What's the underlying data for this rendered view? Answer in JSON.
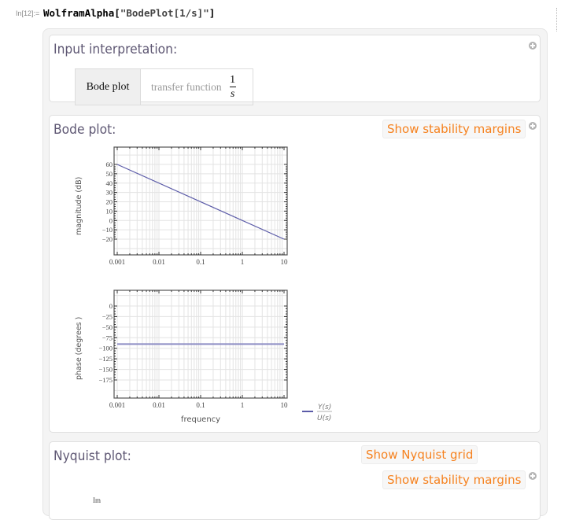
{
  "cell": {
    "in_label": "In[12]:=",
    "code_prefix": "WolframAlpha[",
    "code_string": "\"BodePlot[1/s]\"",
    "code_suffix": "]"
  },
  "pods": {
    "input_interpretation": {
      "title": "Input interpretation:",
      "head": "Bode plot",
      "label": "transfer function",
      "numerator": "1",
      "denominator": "s"
    },
    "bode": {
      "title": "Bode plot:",
      "stability_button": "Show stability margins",
      "magnitude_ylabel": "magnitude   (dB)",
      "phase_ylabel": "phase   (degrees )",
      "xlabel": "frequency",
      "legend_num": "Y(s)",
      "legend_den": "U(s)"
    },
    "nyquist": {
      "title": "Nyquist plot:",
      "grid_button": "Show Nyquist grid",
      "stability_button": "Show stability margins",
      "im_label": "Im"
    }
  },
  "colors": {
    "accent_orange": "#f6821f",
    "pod_title": "#5e5773",
    "series": "#5b5ba8"
  },
  "chart_data": [
    {
      "type": "line",
      "title": "magnitude",
      "xlabel": "",
      "ylabel": "magnitude (dB)",
      "xscale": "log",
      "xlim": [
        0.001,
        10
      ],
      "ylim": [
        -20,
        60
      ],
      "xticks": [
        "0.001",
        "0.01",
        "0.1",
        "1",
        "10"
      ],
      "yticks": [
        "60",
        "50",
        "40",
        "30",
        "20",
        "10",
        "0",
        "-10",
        "-20"
      ],
      "grid": true,
      "series": [
        {
          "name": "Y(s)/U(s)",
          "x": [
            0.001,
            10
          ],
          "y": [
            60,
            -20
          ]
        }
      ]
    },
    {
      "type": "line",
      "title": "phase",
      "xlabel": "frequency",
      "ylabel": "phase (degrees)",
      "xscale": "log",
      "xlim": [
        0.001,
        10
      ],
      "ylim": [
        -175,
        0
      ],
      "xticks": [
        "0.001",
        "0.01",
        "0.1",
        "1",
        "10"
      ],
      "yticks": [
        "0",
        "-25",
        "-50",
        "-75",
        "-100",
        "-125",
        "-150",
        "-175"
      ],
      "grid": true,
      "series": [
        {
          "name": "Y(s)/U(s)",
          "x": [
            0.001,
            10
          ],
          "y": [
            -90,
            -90
          ]
        }
      ],
      "legend": "bottom-right"
    }
  ]
}
